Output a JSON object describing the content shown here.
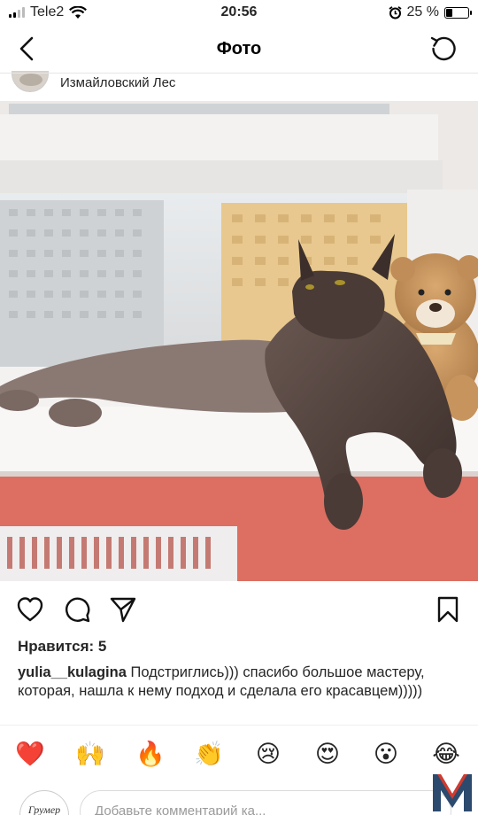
{
  "status_bar": {
    "carrier": "Tele2",
    "time": "20:56",
    "battery_text": "25 %",
    "battery_level": 0.25
  },
  "nav": {
    "title": "Фото",
    "back_icon": "chevron-left-icon",
    "refresh_icon": "refresh-icon"
  },
  "post": {
    "location": "Измайловский Лес",
    "likes": "Нравится: 5",
    "author": "yulia__kulagina",
    "caption": " Подстриглись))) спасибо большое мастеру, которая, нашла к нему подход и сделала его красавцем)))))"
  },
  "actions": [
    "heart-icon",
    "comment-icon",
    "share-icon",
    "bookmark-icon"
  ],
  "emoji_reactions": [
    "❤️",
    "🙌",
    "🔥",
    "👏",
    "😢",
    "😍",
    "😮",
    "😂"
  ],
  "comment_box": {
    "avatar_text": "Грумер",
    "placeholder": "Добавьте комментарий ка..."
  },
  "colors": {
    "text": "#262626",
    "wall": "#dd6e62",
    "heart": "#ed4956"
  }
}
